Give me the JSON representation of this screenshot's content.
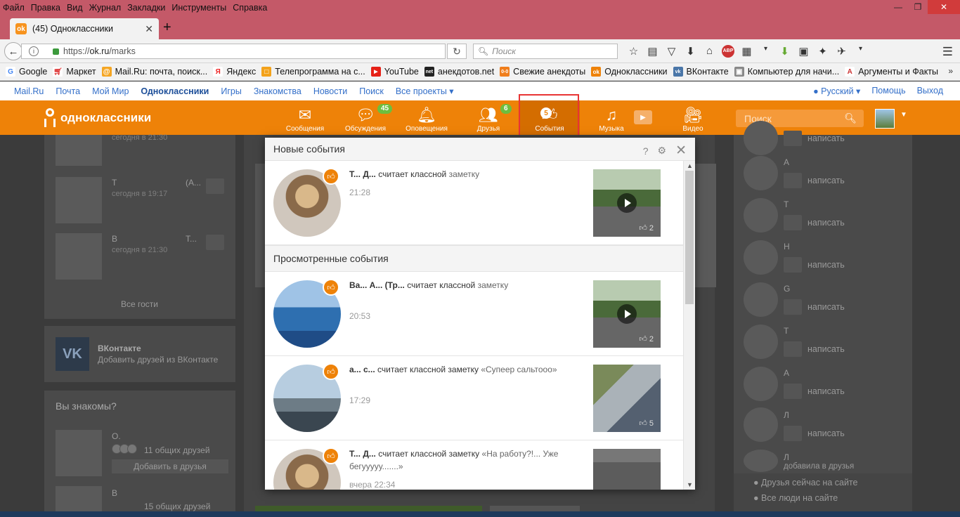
{
  "browser": {
    "menu": [
      "Файл",
      "Правка",
      "Вид",
      "Журнал",
      "Закладки",
      "Инструменты",
      "Справка"
    ],
    "tab_title": "(45) Одноклассники",
    "url_prefix": "https://",
    "url_host": "ok.ru",
    "url_path": "/marks",
    "search_placeholder": "Поиск",
    "bookmarks": [
      {
        "label": "Google",
        "icon": "google-icon",
        "color": "#4285f4"
      },
      {
        "label": "Маркет",
        "icon": "market-icon",
        "color": "#d33"
      },
      {
        "label": "Mail.Ru: почта, поиск...",
        "icon": "mailru-icon",
        "color": "#1a6ec7"
      },
      {
        "label": "Яндекс",
        "icon": "yandex-icon",
        "color": "#e22"
      },
      {
        "label": "Телепрограмма на с...",
        "icon": "tv-icon",
        "color": "#3a7bd5"
      },
      {
        "label": "YouTube",
        "icon": "youtube-icon",
        "color": "#e62117"
      },
      {
        "label": "анекдотов.net",
        "icon": "anekdot-icon",
        "color": "#222"
      },
      {
        "label": "Свежие анекдоты",
        "icon": "anekdot2-icon",
        "color": "#f07e1c"
      },
      {
        "label": "Одноклассники",
        "icon": "ok-icon",
        "color": "#ee8208"
      },
      {
        "label": "ВКонтакте",
        "icon": "vk-icon",
        "color": "#4a76a8"
      },
      {
        "label": "Компьютер для начи...",
        "icon": "computer-icon",
        "color": "#777"
      },
      {
        "label": "Аргументы и Факты",
        "icon": "aif-icon",
        "color": "#c33"
      }
    ]
  },
  "portal": {
    "links": [
      "Mail.Ru",
      "Почта",
      "Мой Мир",
      "Одноклассники",
      "Игры",
      "Знакомства",
      "Новости",
      "Поиск",
      "Все проекты ▾"
    ],
    "current": "Одноклассники",
    "lang": "Русский ▾",
    "help": "Помощь",
    "logout": "Выход"
  },
  "ok": {
    "logo": "одноклассники",
    "nav": [
      {
        "label": "Сообщения",
        "icon": "envelope-icon",
        "badge": ""
      },
      {
        "label": "Обсуждения",
        "icon": "chat-bubbles-icon",
        "badge": "45"
      },
      {
        "label": "Оповещения",
        "icon": "bell-icon",
        "badge": ""
      },
      {
        "label": "Друзья",
        "icon": "friends-icon",
        "badge": "6"
      },
      {
        "label": "События",
        "icon": "thumbs-up-icon",
        "badge": "5"
      },
      {
        "label": "Музыка",
        "icon": "music-note-icon",
        "badge": ""
      },
      {
        "label": "Видео",
        "icon": "video-camera-icon",
        "badge": ""
      }
    ],
    "search_placeholder": "Поиск"
  },
  "background": {
    "guests": [
      {
        "name": "",
        "time": "сегодня в 21:30"
      },
      {
        "name": "Т",
        "time": "сегодня в 19:17",
        "extra": "(А..."
      },
      {
        "name": "В",
        "time": "сегодня в 21:30",
        "extra": "Т..."
      }
    ],
    "all_guests": "Все гости",
    "vk_title": "ВКонтакте",
    "vk_sub": "Добавить друзей из ВКонтакте",
    "know_title": "Вы знакомы?",
    "suggest": [
      {
        "name": "О.",
        "mutual": "11 общих друзей",
        "button": "Добавить в друзья"
      },
      {
        "name": "В",
        "mutual": "15 общих друзей"
      }
    ],
    "right_friends": [
      {
        "name": "",
        "action": "написать"
      },
      {
        "name": "А",
        "action": "написать"
      },
      {
        "name": "Т",
        "action": "написать"
      },
      {
        "name": "Н",
        "action": "написать"
      },
      {
        "name": "G",
        "action": "написать"
      },
      {
        "name": "Т",
        "action": "написать"
      },
      {
        "name": "А",
        "action": "написать"
      },
      {
        "name": "Л",
        "action": "написать"
      },
      {
        "name": "Л",
        "action": "добавила в друзья"
      }
    ],
    "friends_online": "Друзья сейчас на сайте",
    "all_online": "Все люди на сайте"
  },
  "popup": {
    "title": "Новые события",
    "viewed_title": "Просмотренные события",
    "new_events": [
      {
        "who": "Т... Д...",
        "action": "считает классной",
        "object": "заметку",
        "time": "21:28",
        "likes": "2"
      }
    ],
    "viewed_events": [
      {
        "who": "Ва... А... (Тр...",
        "action": "считает классной",
        "object": "заметку",
        "time": "20:53",
        "likes": "2"
      },
      {
        "who": "а... с...",
        "action": "считает классной заметку",
        "object": "«Супеер сальтооо»",
        "time": "17:29",
        "likes": "5"
      },
      {
        "who": "Т... Д...",
        "action": "считает классной заметку",
        "object": "«На работу?!... Уже бегууууу.......»",
        "time": "вчера 22:34",
        "likes": ""
      }
    ]
  }
}
